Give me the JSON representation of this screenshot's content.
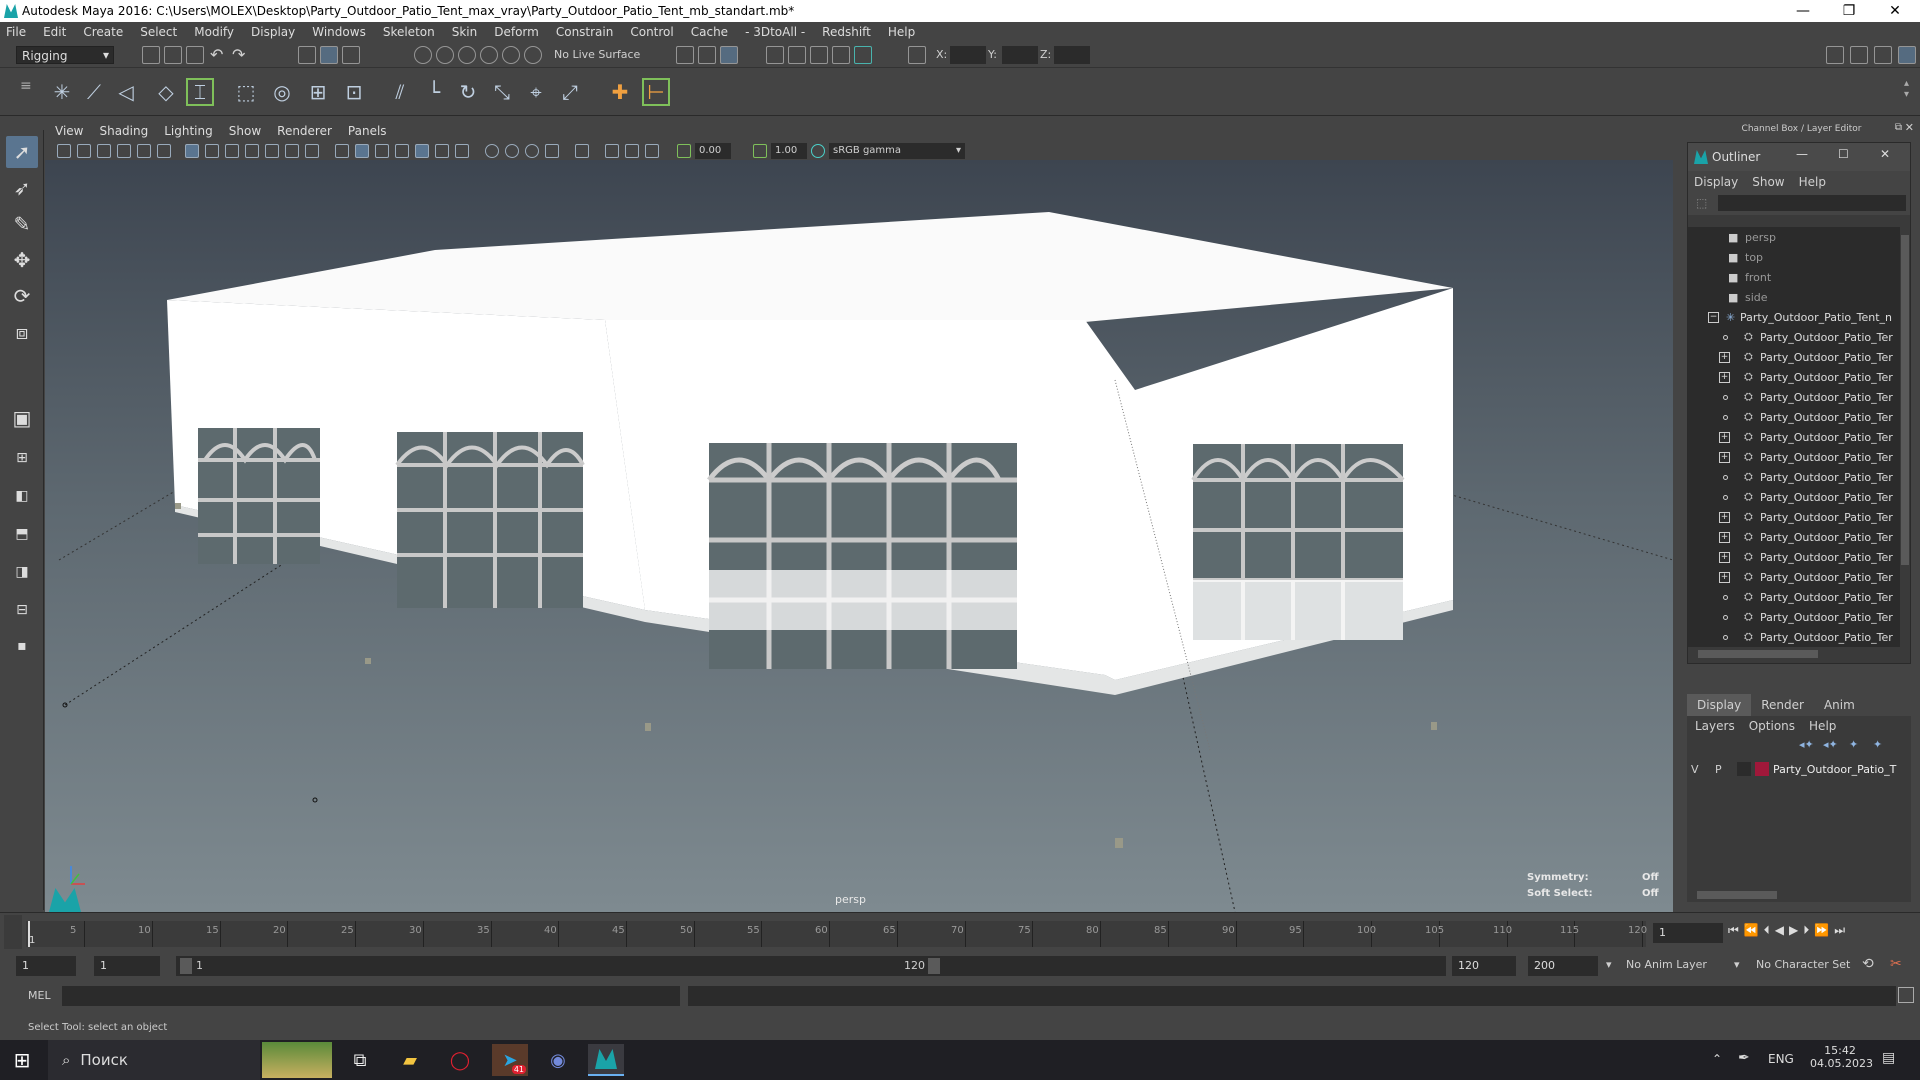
{
  "window": {
    "title": "Autodesk Maya 2016: C:\\Users\\MOLEX\\Desktop\\Party_Outdoor_Patio_Tent_max_vray\\Party_Outdoor_Patio_Tent_mb_standart.mb*",
    "minimize": "—",
    "maximize": "❐",
    "close": "✕"
  },
  "menubar": [
    "File",
    "Edit",
    "Create",
    "Select",
    "Modify",
    "Display",
    "Windows",
    "Skeleton",
    "Skin",
    "Deform",
    "Constrain",
    "Control",
    "Cache",
    "- 3DtoAll -",
    "Redshift",
    "Help"
  ],
  "statusline": {
    "menuset": "Rigging",
    "live_surface": "No Live Surface",
    "x_label": "X:",
    "y_label": "Y:",
    "z_label": "Z:"
  },
  "panel": {
    "menu": [
      "View",
      "Shading",
      "Lighting",
      "Show",
      "Renderer",
      "Panels"
    ],
    "exposure": "0.00",
    "gamma": "1.00",
    "colorspace": "sRGB gamma",
    "camera_label": "persp",
    "symmetry_label": "Symmetry:",
    "symmetry_value": "Off",
    "soft_select_label": "Soft Select:",
    "soft_select_value": "Off"
  },
  "channel_box": {
    "title": "Channel Box / Layer Editor"
  },
  "outliner": {
    "title": "Outliner",
    "menu": [
      "Display",
      "Show",
      "Help"
    ],
    "cameras": [
      "persp",
      "top",
      "front",
      "side"
    ],
    "root": "Party_Outdoor_Patio_Tent_n",
    "children": [
      {
        "label": "Party_Outdoor_Patio_Ter",
        "expandable": false
      },
      {
        "label": "Party_Outdoor_Patio_Ter",
        "expandable": true
      },
      {
        "label": "Party_Outdoor_Patio_Ter",
        "expandable": true
      },
      {
        "label": "Party_Outdoor_Patio_Ter",
        "expandable": false
      },
      {
        "label": "Party_Outdoor_Patio_Ter",
        "expandable": false
      },
      {
        "label": "Party_Outdoor_Patio_Ter",
        "expandable": true
      },
      {
        "label": "Party_Outdoor_Patio_Ter",
        "expandable": true
      },
      {
        "label": "Party_Outdoor_Patio_Ter",
        "expandable": false
      },
      {
        "label": "Party_Outdoor_Patio_Ter",
        "expandable": false
      },
      {
        "label": "Party_Outdoor_Patio_Ter",
        "expandable": true
      },
      {
        "label": "Party_Outdoor_Patio_Ter",
        "expandable": true
      },
      {
        "label": "Party_Outdoor_Patio_Ter",
        "expandable": true
      },
      {
        "label": "Party_Outdoor_Patio_Ter",
        "expandable": true
      },
      {
        "label": "Party_Outdoor_Patio_Ter",
        "expandable": false
      },
      {
        "label": "Party_Outdoor_Patio_Ter",
        "expandable": false
      },
      {
        "label": "Party_Outdoor_Patio_Ter",
        "expandable": false
      },
      {
        "label": "Party_Outdoor_Patio_Ter",
        "expandable": false
      }
    ]
  },
  "layer_editor": {
    "tabs": [
      "Display",
      "Render",
      "Anim"
    ],
    "menu": [
      "Layers",
      "Options",
      "Help"
    ],
    "layer": {
      "v": "V",
      "p": "P",
      "name": "Party_Outdoor_Patio_T",
      "color": "#a0183a"
    }
  },
  "timeline": {
    "ticks": [
      "5",
      "10",
      "15",
      "20",
      "25",
      "30",
      "35",
      "40",
      "45",
      "50",
      "55",
      "60",
      "65",
      "70",
      "75",
      "80",
      "85",
      "90",
      "95",
      "100",
      "105",
      "110",
      "115",
      "120"
    ],
    "start_label": "1",
    "current_frame": "1"
  },
  "range": {
    "start": "1",
    "anim_start": "1",
    "slider_start": "1",
    "slider_end": "120",
    "end": "120",
    "anim_end": "200",
    "anim_layer": "No Anim Layer",
    "character_set": "No Character Set"
  },
  "mel": {
    "label": "MEL"
  },
  "helpline": "Select Tool: select an object",
  "taskbar": {
    "search": "Поиск",
    "lang": "ENG",
    "time": "15:42",
    "date": "04.05.2023",
    "telegram_badge": "41"
  }
}
